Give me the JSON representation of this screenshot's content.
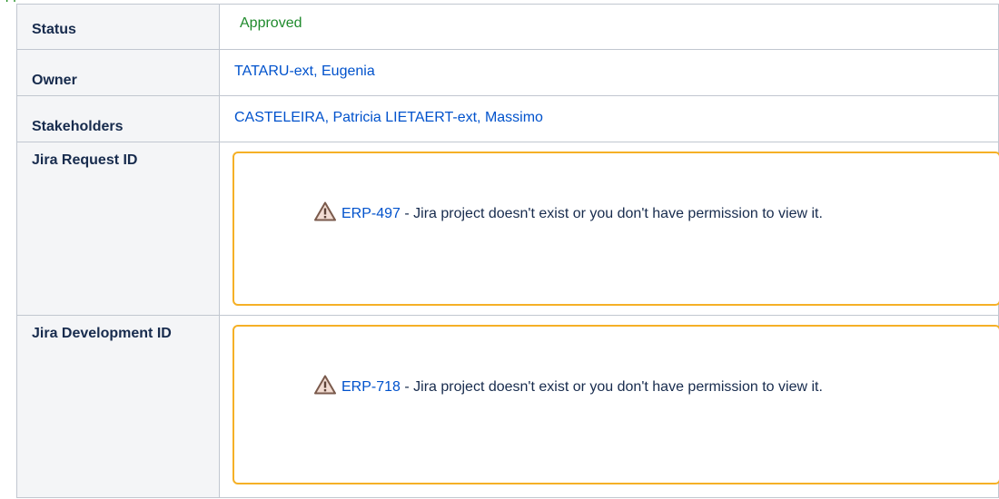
{
  "header_fragment": "pp",
  "rows": {
    "status": {
      "label": "Status",
      "value": "Approved"
    },
    "owner": {
      "label": "Owner",
      "value": "TATARU-ext, Eugenia"
    },
    "stakeholders": {
      "label": "Stakeholders",
      "values": [
        "CASTELEIRA, Patricia",
        "LIETAERT-ext, Massimo"
      ]
    },
    "jira_request": {
      "label": "Jira Request ID",
      "issue_key": "ERP-497",
      "message": " - Jira project doesn't exist or you don't have permission to view it."
    },
    "jira_development": {
      "label": "Jira Development ID",
      "issue_key": "ERP-718",
      "message": " - Jira project doesn't exist or you don't have permission to view it."
    }
  },
  "colors": {
    "status_green": "#1f8a2c",
    "link_blue": "#0052cc",
    "warning_border": "#f5b026",
    "key_background": "#f4f5f7",
    "grid_border": "#c1c7d0"
  },
  "icons": {
    "warning": "warning-triangle-icon"
  }
}
